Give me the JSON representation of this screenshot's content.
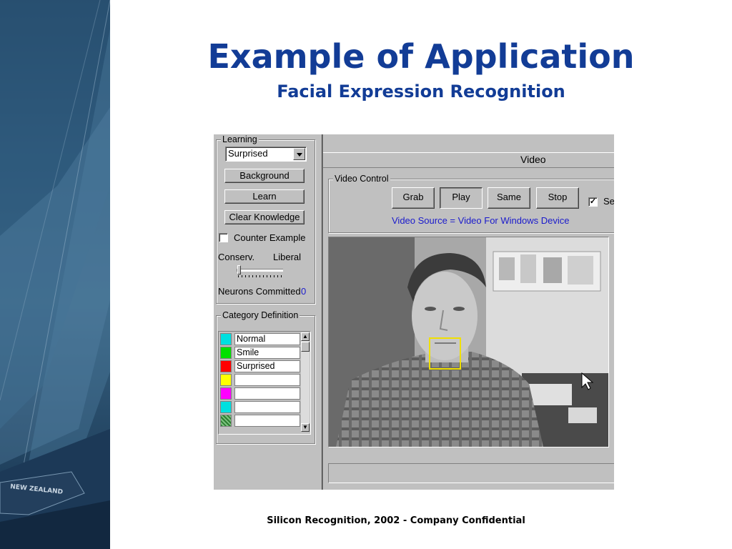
{
  "slide": {
    "title": "Example of Application",
    "subtitle": "Facial Expression Recognition",
    "footer": "Silicon Recognition, 2002 - Company Confidential",
    "side_image_text": "NEW ZEALAND"
  },
  "colors": {
    "title": "#123c96",
    "window": "#c0c0c0",
    "link_text": "#1a1acc",
    "roi_box": "#f0e000"
  },
  "learning": {
    "group_label": "Learning",
    "selected_category": "Surprised",
    "background_label": "Background",
    "learn_label": "Learn",
    "clear_label": "Clear Knowledge",
    "counter_example_label": "Counter Example",
    "counter_example_checked": false,
    "conserv_label": "Conserv.",
    "liberal_label": "Liberal",
    "slider_value": 0,
    "neurons_label": "Neurons Committed",
    "neurons_value": "0"
  },
  "category": {
    "group_label": "Category Definition",
    "items": [
      {
        "name": "Normal",
        "color": "#00e0e0"
      },
      {
        "name": "Smile",
        "color": "#00e000"
      },
      {
        "name": "Surprised",
        "color": "#ff0000"
      },
      {
        "name": "",
        "color": "#ffff00"
      },
      {
        "name": "",
        "color": "#ff00ff"
      },
      {
        "name": "",
        "color": "#00e0e0"
      },
      {
        "name": "",
        "color": "#2e7d32"
      }
    ]
  },
  "video": {
    "title": "Video",
    "control_label": "Video Control",
    "grab_label": "Grab",
    "play_label": "Play",
    "same_label": "Same",
    "stop_label": "Stop",
    "truncated_checkbox_label": "Se",
    "truncated_checkbox_checked": true,
    "source_text": "Video Source = Video For Windows Device"
  }
}
